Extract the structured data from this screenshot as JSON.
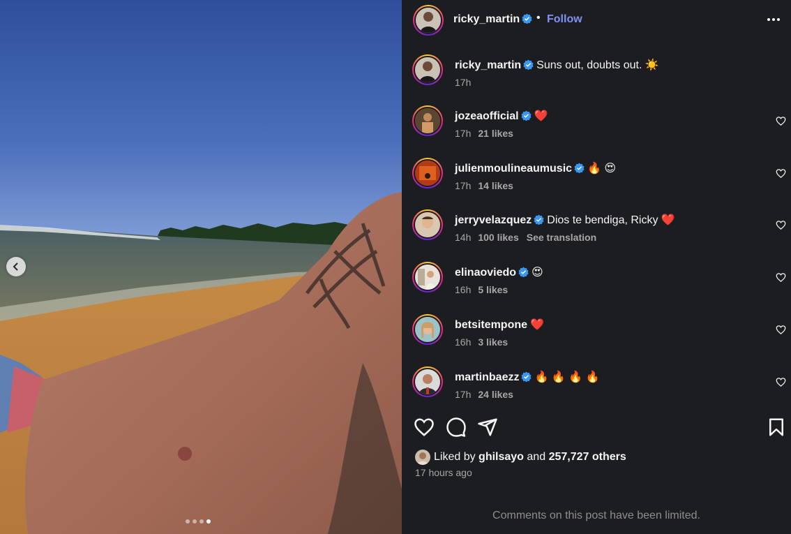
{
  "post": {
    "author": "ricky_martin",
    "follow_label": "Follow",
    "separator": "•",
    "caption_text": "Suns out, doubts out. ☀️",
    "caption_time": "17h",
    "carousel": {
      "current_index": 4,
      "total": 4
    }
  },
  "comments": [
    {
      "username": "jozeaofficial",
      "verified": true,
      "text": "❤️",
      "time": "17h",
      "likes": "21 likes",
      "translation": ""
    },
    {
      "username": "julienmoulineaumusic",
      "verified": true,
      "text": "🔥 😍",
      "time": "17h",
      "likes": "14 likes",
      "translation": ""
    },
    {
      "username": "jerryvelazquez",
      "verified": true,
      "text": "Dios te bendiga, Ricky ❤️",
      "time": "14h",
      "likes": "100 likes",
      "translation": "See translation"
    },
    {
      "username": "elinaoviedo",
      "verified": true,
      "text": "😍",
      "time": "16h",
      "likes": "5 likes",
      "translation": ""
    },
    {
      "username": "betsitempone",
      "verified": false,
      "text": "❤️",
      "time": "16h",
      "likes": "3 likes",
      "translation": ""
    },
    {
      "username": "martinbaezz",
      "verified": true,
      "text": "🔥 🔥 🔥 🔥",
      "time": "17h",
      "likes": "24 likes",
      "translation": ""
    }
  ],
  "likes_summary": {
    "prefix": "Liked by",
    "user": "ghilsayo",
    "joiner": "and",
    "others": "257,727 others",
    "time_ago": "17 hours ago"
  },
  "footer": {
    "limited_notice": "Comments on this post have been limited."
  },
  "icons": {
    "verified": "verified-badge-icon",
    "more": "more-options-icon",
    "like": "heart-icon",
    "comment": "comment-icon",
    "share": "share-icon",
    "save": "bookmark-icon",
    "prev": "chevron-left-icon"
  },
  "colors": {
    "panel_bg": "#1c1d21",
    "follow": "#7f93f5",
    "verified": "#3897f0",
    "secondary_text": "#a8a8a8"
  }
}
